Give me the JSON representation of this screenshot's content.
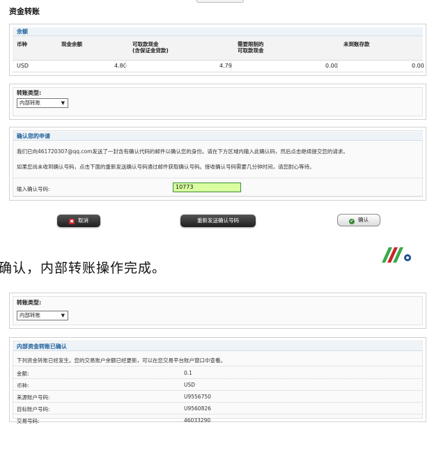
{
  "page_title": "资金转账",
  "balance": {
    "header": "余额",
    "columns": [
      "币种",
      "现金余额",
      "可取款现金\n(含保证金贷款)",
      "需要限制的\n可取款现金",
      "未到账存款"
    ],
    "row": [
      "USD",
      "4.80",
      "4.79",
      "0.00",
      "0.00"
    ]
  },
  "transfer_type_1": {
    "label": "转账类型:",
    "selected": "内部转账",
    "arrow": "▼"
  },
  "confirm_request": {
    "header": "确认您的申请",
    "line1": "我们已向461720307@qq.com发送了一封含有确认代码的邮件以确认您的身份。请在下方区域内输入此确认码，然后点击继续提交您的请求。",
    "line2": "如果您尚未收到确认号码，点击下面的重新发送确认号码通过邮件获取确认号码。接收确认号码需要几分钟时间，请您耐心等待。",
    "input_label": "输入确认号码:",
    "input_value": "10773"
  },
  "buttons": {
    "cancel": "取消",
    "resend": "重新发送确认号码",
    "confirm": "确认",
    "cancel_icon": "✖",
    "confirm_icon": "✔"
  },
  "caption": "确认，内部转账操作完成。",
  "transfer_type_2": {
    "label": "转账类型:",
    "selected": "内部转账",
    "arrow": "▼"
  },
  "result": {
    "header": "内部资金转账已确认",
    "note": "下列资金转账已经发生。您的交易账户余额已经更新，可以在您交易平台账户窗口中查看。",
    "rows": [
      {
        "k": "金额:",
        "v": "0.1"
      },
      {
        "k": "币种:",
        "v": "USD"
      },
      {
        "k": "来源账户号码:",
        "v": "U9556750"
      },
      {
        "k": "目标账户号码:",
        "v": "U9560826"
      },
      {
        "k": "交易号码:",
        "v": "46033290"
      }
    ]
  },
  "colors": {
    "section_title": "#1c5f99",
    "input_bg": "#d9ffa0",
    "logo_green": "#3aa84a",
    "logo_red": "#c9242b",
    "logo_blue": "#1d4f8f"
  }
}
